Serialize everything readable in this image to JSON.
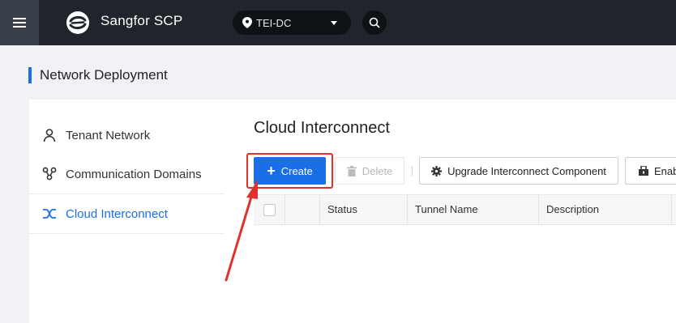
{
  "topbar": {
    "brand": "Sangfor SCP",
    "region": "TEI-DC",
    "icons": {
      "menu": "hamburger-menu-icon",
      "logo": "sangfor-logo",
      "region": "location-pin-icon",
      "search": "search-icon"
    }
  },
  "page": {
    "title": "Network Deployment"
  },
  "sidebar": {
    "items": [
      {
        "label": "Tenant Network",
        "icon": "user-icon",
        "active": false
      },
      {
        "label": "Communication Domains",
        "icon": "nodes-icon",
        "active": false
      },
      {
        "label": "Cloud Interconnect",
        "icon": "interconnect-icon",
        "active": true
      }
    ]
  },
  "content": {
    "title": "Cloud Interconnect",
    "toolbar": {
      "create_label": "Create",
      "delete_label": "Delete",
      "upgrade_label": "Upgrade Interconnect Component",
      "enable_label": "Enab"
    },
    "table": {
      "columns": [
        "Status",
        "Tunnel Name",
        "Description"
      ]
    }
  },
  "colors": {
    "accent": "#1a6fe8",
    "highlight": "#e0322d",
    "topbar": "#20252c"
  }
}
